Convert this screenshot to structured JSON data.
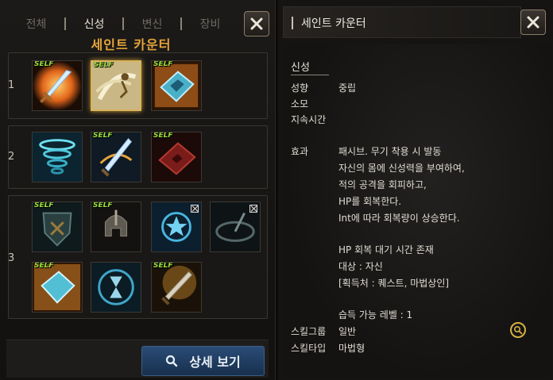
{
  "tabs": [
    "전체",
    "신성",
    "변신",
    "장비"
  ],
  "class_title": "세인트 카운터",
  "self_badge": "SELF",
  "rows": [
    {
      "number": "1"
    },
    {
      "number": "2"
    },
    {
      "number": "3"
    }
  ],
  "detail_button": "상세 보기",
  "right": {
    "header_title": "세인트 카운터",
    "skill_name": "신성",
    "labels": {
      "alignment": "성향",
      "cost": "소모",
      "duration": "지속시간",
      "effect": "효과",
      "skill_group": "스킬그룹",
      "skill_type": "스킬타입"
    },
    "alignment_value": "중립",
    "effect_lines": [
      "패시브. 무기 착용 시 발동",
      "자신의 몸에 신성력을 부여하여,",
      "적의 공격을 회피하고,",
      "HP를 회복한다.",
      "Int에 따라 회복량이 상승한다."
    ],
    "extra_lines": [
      "HP 회복 대기 시간 존재",
      "대상 : 자신",
      "[획득처 : 퀘스트, 마법상인]"
    ],
    "learn_level": "습득 가능 레벨 : 1",
    "skill_group_value": "일반",
    "skill_type_value": "마법형"
  },
  "colors": {
    "accent_gold": "#e6a53a",
    "self_green": "#9ae03b",
    "button_blue": "#2a4c76"
  }
}
